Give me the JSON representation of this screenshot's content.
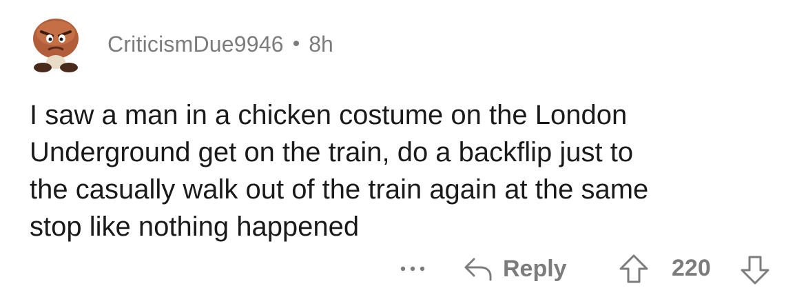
{
  "comment": {
    "username": "CriticismDue9946",
    "separator": "•",
    "time": "8h",
    "avatar_icon": "goomba-avatar-icon",
    "body": "I saw a man in a chicken costume on the London\nUnderground get on the train, do a backflip just to\nthe casually walk out of the train again at the same\nstop like nothing happened"
  },
  "actions": {
    "more_icon": "more-options-icon",
    "reply_icon": "reply-arrow-icon",
    "reply_label": "Reply",
    "upvote_icon": "upvote-arrow-icon",
    "score": "220",
    "downvote_icon": "downvote-arrow-icon"
  },
  "colors": {
    "text": "#1a1a1b",
    "meta": "#7c7c7c",
    "background": "#ffffff"
  }
}
